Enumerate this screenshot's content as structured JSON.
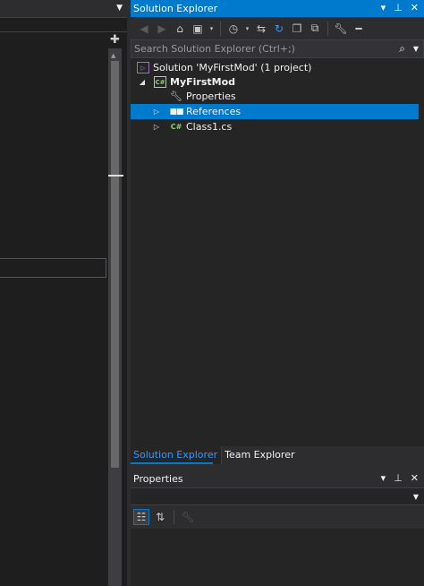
{
  "solution_explorer": {
    "title": "Solution Explorer",
    "search_placeholder": "Search Solution Explorer (Ctrl+;)",
    "window_controls": [
      "▾",
      "⊥",
      "✕"
    ],
    "toolbar_icons": [
      "back-icon",
      "forward-icon",
      "home-icon",
      "switch-views-icon",
      "pending-changes-filter-icon",
      "sync-icon",
      "refresh-icon",
      "collapse-all-icon",
      "show-all-files-icon",
      "properties-icon",
      "preview-icon"
    ],
    "tree": [
      {
        "label": "Solution 'MyFirstMod' (1 project)",
        "expander": "",
        "icon": "solution-icon",
        "bold": false,
        "selected": false
      },
      {
        "label": "MyFirstMod",
        "expander": "◢",
        "icon": "csharp-project-icon",
        "bold": true,
        "selected": false
      },
      {
        "label": "Properties",
        "expander": "",
        "icon": "wrench-icon",
        "bold": false,
        "selected": false
      },
      {
        "label": "References",
        "expander": "▷",
        "icon": "references-icon",
        "bold": false,
        "selected": true
      },
      {
        "label": "Class1.cs",
        "expander": "▷",
        "icon": "csharp-file-icon",
        "bold": false,
        "selected": false
      }
    ],
    "tabs": [
      {
        "label": "Solution Explorer",
        "active": true
      },
      {
        "label": "Team Explorer",
        "active": false
      }
    ]
  },
  "properties": {
    "title": "Properties",
    "window_controls": [
      "▾",
      "⊥",
      "✕"
    ],
    "toolbar_icons": [
      "categorized-icon",
      "alphabetical-icon",
      "property-pages-icon"
    ]
  },
  "editor": {
    "splitter_glyph": "✚"
  },
  "colors": {
    "accent": "#007acc",
    "background": "#1e1e1e",
    "panel": "#252526",
    "active_tab_text": "#3399ff"
  }
}
